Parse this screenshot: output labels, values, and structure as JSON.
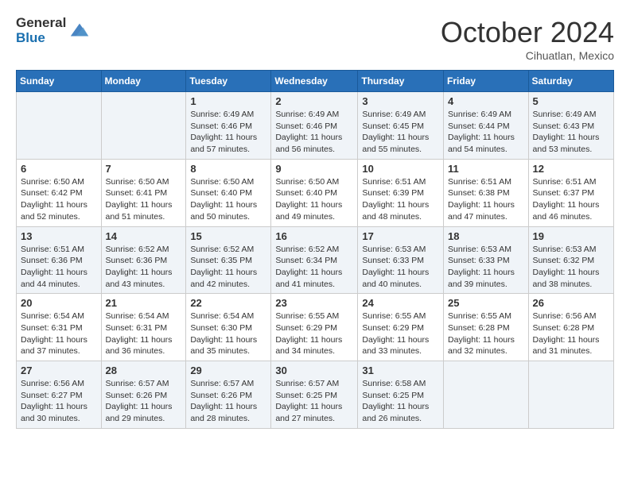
{
  "header": {
    "logo": {
      "line1": "General",
      "line2": "Blue"
    },
    "title": "October 2024",
    "location": "Cihuatlan, Mexico"
  },
  "calendar": {
    "weekdays": [
      "Sunday",
      "Monday",
      "Tuesday",
      "Wednesday",
      "Thursday",
      "Friday",
      "Saturday"
    ],
    "weeks": [
      [
        {
          "day": "",
          "detail": ""
        },
        {
          "day": "",
          "detail": ""
        },
        {
          "day": "1",
          "detail": "Sunrise: 6:49 AM\nSunset: 6:46 PM\nDaylight: 11 hours and 57 minutes."
        },
        {
          "day": "2",
          "detail": "Sunrise: 6:49 AM\nSunset: 6:46 PM\nDaylight: 11 hours and 56 minutes."
        },
        {
          "day": "3",
          "detail": "Sunrise: 6:49 AM\nSunset: 6:45 PM\nDaylight: 11 hours and 55 minutes."
        },
        {
          "day": "4",
          "detail": "Sunrise: 6:49 AM\nSunset: 6:44 PM\nDaylight: 11 hours and 54 minutes."
        },
        {
          "day": "5",
          "detail": "Sunrise: 6:49 AM\nSunset: 6:43 PM\nDaylight: 11 hours and 53 minutes."
        }
      ],
      [
        {
          "day": "6",
          "detail": "Sunrise: 6:50 AM\nSunset: 6:42 PM\nDaylight: 11 hours and 52 minutes."
        },
        {
          "day": "7",
          "detail": "Sunrise: 6:50 AM\nSunset: 6:41 PM\nDaylight: 11 hours and 51 minutes."
        },
        {
          "day": "8",
          "detail": "Sunrise: 6:50 AM\nSunset: 6:40 PM\nDaylight: 11 hours and 50 minutes."
        },
        {
          "day": "9",
          "detail": "Sunrise: 6:50 AM\nSunset: 6:40 PM\nDaylight: 11 hours and 49 minutes."
        },
        {
          "day": "10",
          "detail": "Sunrise: 6:51 AM\nSunset: 6:39 PM\nDaylight: 11 hours and 48 minutes."
        },
        {
          "day": "11",
          "detail": "Sunrise: 6:51 AM\nSunset: 6:38 PM\nDaylight: 11 hours and 47 minutes."
        },
        {
          "day": "12",
          "detail": "Sunrise: 6:51 AM\nSunset: 6:37 PM\nDaylight: 11 hours and 46 minutes."
        }
      ],
      [
        {
          "day": "13",
          "detail": "Sunrise: 6:51 AM\nSunset: 6:36 PM\nDaylight: 11 hours and 44 minutes."
        },
        {
          "day": "14",
          "detail": "Sunrise: 6:52 AM\nSunset: 6:36 PM\nDaylight: 11 hours and 43 minutes."
        },
        {
          "day": "15",
          "detail": "Sunrise: 6:52 AM\nSunset: 6:35 PM\nDaylight: 11 hours and 42 minutes."
        },
        {
          "day": "16",
          "detail": "Sunrise: 6:52 AM\nSunset: 6:34 PM\nDaylight: 11 hours and 41 minutes."
        },
        {
          "day": "17",
          "detail": "Sunrise: 6:53 AM\nSunset: 6:33 PM\nDaylight: 11 hours and 40 minutes."
        },
        {
          "day": "18",
          "detail": "Sunrise: 6:53 AM\nSunset: 6:33 PM\nDaylight: 11 hours and 39 minutes."
        },
        {
          "day": "19",
          "detail": "Sunrise: 6:53 AM\nSunset: 6:32 PM\nDaylight: 11 hours and 38 minutes."
        }
      ],
      [
        {
          "day": "20",
          "detail": "Sunrise: 6:54 AM\nSunset: 6:31 PM\nDaylight: 11 hours and 37 minutes."
        },
        {
          "day": "21",
          "detail": "Sunrise: 6:54 AM\nSunset: 6:31 PM\nDaylight: 11 hours and 36 minutes."
        },
        {
          "day": "22",
          "detail": "Sunrise: 6:54 AM\nSunset: 6:30 PM\nDaylight: 11 hours and 35 minutes."
        },
        {
          "day": "23",
          "detail": "Sunrise: 6:55 AM\nSunset: 6:29 PM\nDaylight: 11 hours and 34 minutes."
        },
        {
          "day": "24",
          "detail": "Sunrise: 6:55 AM\nSunset: 6:29 PM\nDaylight: 11 hours and 33 minutes."
        },
        {
          "day": "25",
          "detail": "Sunrise: 6:55 AM\nSunset: 6:28 PM\nDaylight: 11 hours and 32 minutes."
        },
        {
          "day": "26",
          "detail": "Sunrise: 6:56 AM\nSunset: 6:28 PM\nDaylight: 11 hours and 31 minutes."
        }
      ],
      [
        {
          "day": "27",
          "detail": "Sunrise: 6:56 AM\nSunset: 6:27 PM\nDaylight: 11 hours and 30 minutes."
        },
        {
          "day": "28",
          "detail": "Sunrise: 6:57 AM\nSunset: 6:26 PM\nDaylight: 11 hours and 29 minutes."
        },
        {
          "day": "29",
          "detail": "Sunrise: 6:57 AM\nSunset: 6:26 PM\nDaylight: 11 hours and 28 minutes."
        },
        {
          "day": "30",
          "detail": "Sunrise: 6:57 AM\nSunset: 6:25 PM\nDaylight: 11 hours and 27 minutes."
        },
        {
          "day": "31",
          "detail": "Sunrise: 6:58 AM\nSunset: 6:25 PM\nDaylight: 11 hours and 26 minutes."
        },
        {
          "day": "",
          "detail": ""
        },
        {
          "day": "",
          "detail": ""
        }
      ]
    ]
  }
}
